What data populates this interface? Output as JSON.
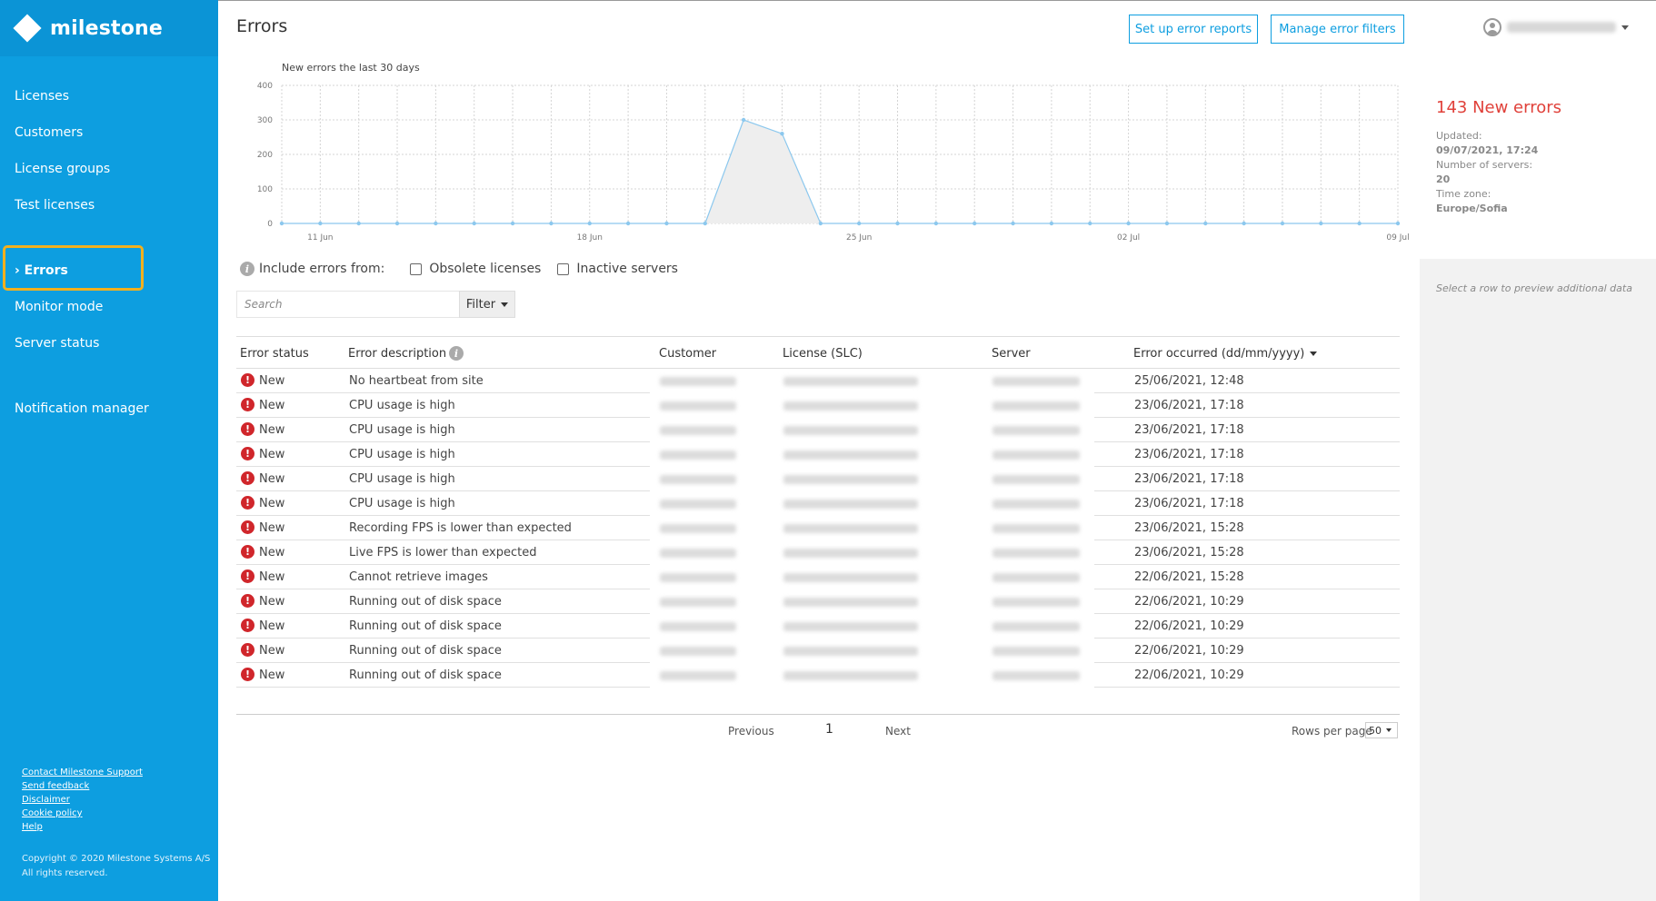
{
  "brand": {
    "name": "milestone"
  },
  "sidebar": {
    "items": [
      {
        "label": "Licenses"
      },
      {
        "label": "Customers"
      },
      {
        "label": "License groups"
      },
      {
        "label": "Test licenses"
      },
      {
        "label": "› Errors"
      },
      {
        "label": "Monitor mode"
      },
      {
        "label": "Server status"
      },
      {
        "label": "Notification manager"
      }
    ],
    "footer_links": [
      "Contact Milestone Support",
      "Send feedback",
      "Disclaimer",
      "Cookie policy",
      "Help"
    ],
    "copyright_line1": "Copyright © 2020 Milestone Systems A/S",
    "copyright_line2": "All rights reserved."
  },
  "header": {
    "title": "Errors",
    "setup_button": "Set up error reports",
    "manage_button": "Manage error filters"
  },
  "chart_data": {
    "type": "area",
    "title": "New errors the last 30 days",
    "x": [
      "10 Jun",
      "11 Jun",
      "12 Jun",
      "13 Jun",
      "14 Jun",
      "15 Jun",
      "16 Jun",
      "17 Jun",
      "18 Jun",
      "19 Jun",
      "20 Jun",
      "21 Jun",
      "22 Jun",
      "23 Jun",
      "24 Jun",
      "25 Jun",
      "26 Jun",
      "27 Jun",
      "28 Jun",
      "29 Jun",
      "30 Jun",
      "01 Jul",
      "02 Jul",
      "03 Jul",
      "04 Jul",
      "05 Jul",
      "06 Jul",
      "07 Jul",
      "08 Jul",
      "09 Jul"
    ],
    "values": [
      0,
      0,
      0,
      0,
      0,
      0,
      0,
      0,
      0,
      0,
      0,
      0,
      300,
      260,
      0,
      0,
      0,
      0,
      0,
      0,
      0,
      0,
      0,
      0,
      0,
      0,
      0,
      0,
      0,
      0
    ],
    "x_tick_labels": [
      "11 Jun",
      "18 Jun",
      "25 Jun",
      "02 Jul",
      "09 Jul"
    ],
    "y_ticks": [
      0,
      100,
      200,
      300,
      400
    ],
    "ylim": [
      0,
      400
    ],
    "grid": true,
    "line_color": "#8cc8ee",
    "fill_color": "#eeeeee"
  },
  "summary": {
    "headline": "143 New errors",
    "updated_label": "Updated:",
    "updated_value": "09/07/2021, 17:24",
    "servers_label": "Number of servers:",
    "servers_value": "20",
    "tz_label": "Time zone:",
    "tz_value": "Europe/Sofia",
    "preview_hint": "Select a row to preview additional data"
  },
  "filters": {
    "include_label": "Include errors from:",
    "obsolete_label": "Obsolete licenses",
    "inactive_label": "Inactive servers",
    "search_placeholder": "Search",
    "filter_button": "Filter"
  },
  "table": {
    "headers": [
      "Error status",
      "Error description",
      "Customer",
      "License (SLC)",
      "Server",
      "Error occurred (dd/mm/yyyy)"
    ],
    "rows": [
      {
        "status": "New",
        "description": "No heartbeat from site",
        "occurred": "25/06/2021, 12:48"
      },
      {
        "status": "New",
        "description": "CPU usage is high",
        "occurred": "23/06/2021, 17:18"
      },
      {
        "status": "New",
        "description": "CPU usage is high",
        "occurred": "23/06/2021, 17:18"
      },
      {
        "status": "New",
        "description": "CPU usage is high",
        "occurred": "23/06/2021, 17:18"
      },
      {
        "status": "New",
        "description": "CPU usage is high",
        "occurred": "23/06/2021, 17:18"
      },
      {
        "status": "New",
        "description": "CPU usage is high",
        "occurred": "23/06/2021, 17:18"
      },
      {
        "status": "New",
        "description": "Recording FPS is lower than expected",
        "occurred": "23/06/2021, 15:28"
      },
      {
        "status": "New",
        "description": "Live FPS is lower than expected",
        "occurred": "23/06/2021, 15:28"
      },
      {
        "status": "New",
        "description": "Cannot retrieve images",
        "occurred": "22/06/2021, 15:28"
      },
      {
        "status": "New",
        "description": "Running out of disk space",
        "occurred": "22/06/2021, 10:29"
      },
      {
        "status": "New",
        "description": "Running out of disk space",
        "occurred": "22/06/2021, 10:29"
      },
      {
        "status": "New",
        "description": "Running out of disk space",
        "occurred": "22/06/2021, 10:29"
      },
      {
        "status": "New",
        "description": "Running out of disk space",
        "occurred": "22/06/2021, 10:29"
      }
    ]
  },
  "pagination": {
    "previous": "Previous",
    "page": "1",
    "next": "Next",
    "rows_label": "Rows per page",
    "rows_value": "50"
  },
  "colors": {
    "sidebar": "#0d9ee0",
    "highlight": "#f2b01e",
    "error": "#d0262b",
    "accent": "#0d9ee0"
  }
}
